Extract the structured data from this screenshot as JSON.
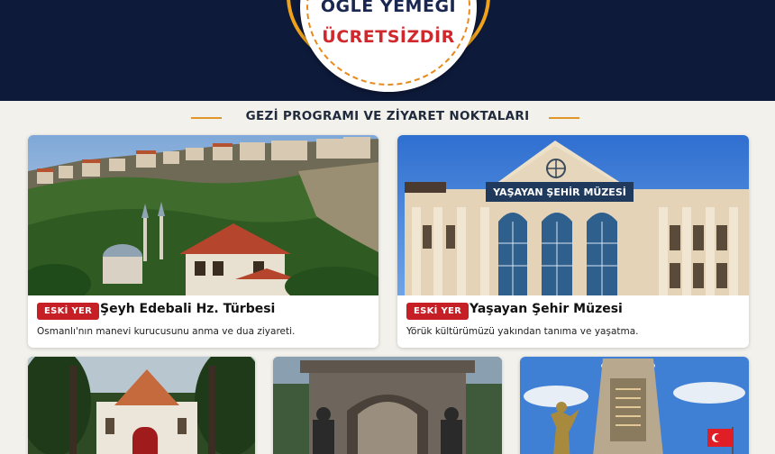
{
  "badge": {
    "line1": "ÖĞLE YEMEĞİ",
    "line2": "ÜCRETSİZDİR"
  },
  "section": {
    "title": "GEZİ PROGRAMI VE ZİYARET NOKTALARI"
  },
  "cards": [
    {
      "tag": "ESKİ YER",
      "title": "Şeyh Edebali Hz. Türbesi",
      "description": "Osmanlı'nın manevi kurucusunu anma ve dua ziyareti."
    },
    {
      "tag": "ESKİ YER",
      "title": "Yaşayan Şehir Müzesi",
      "description": "Yörük kültürümüzü yakından tanıma ve yaşatma.",
      "sign": "YAŞAYAN ŞEHİR MÜZESİ"
    }
  ],
  "colors": {
    "navy": "#0e1a3a",
    "accent_orange": "#f0a21a",
    "tag_red": "#c62026",
    "badge_red": "#d0282c"
  }
}
